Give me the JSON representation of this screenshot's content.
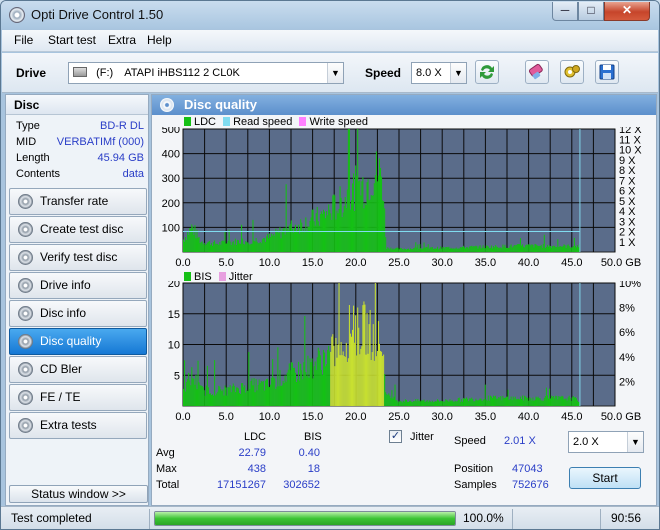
{
  "window": {
    "title": "Opti Drive Control 1.50",
    "controls": {
      "minimize": "─",
      "maximize": "□",
      "close": "✕"
    }
  },
  "menu": [
    "File",
    "Start test",
    "Extra",
    "Help"
  ],
  "toolbar": {
    "drive_label": "Drive",
    "drive_letter": "(F:)",
    "drive_value": "ATAPI  iHBS112   2 CL0K",
    "speed_label": "Speed",
    "speed_value": "8.0 X",
    "icons": [
      "refresh-icon",
      "eraser-icon",
      "settings-icon",
      "save-icon"
    ]
  },
  "sidebar": {
    "disc_header": "Disc",
    "info": [
      {
        "key": "Type",
        "value": "BD-R DL"
      },
      {
        "key": "MID",
        "value": "VERBATIMf (000)"
      },
      {
        "key": "Length",
        "value": "45.94 GB"
      },
      {
        "key": "Contents",
        "value": "data"
      }
    ],
    "nav": [
      "Transfer rate",
      "Create test disc",
      "Verify test disc",
      "Drive info",
      "Disc info",
      "Disc quality",
      "CD Bler",
      "FE / TE",
      "Extra tests"
    ],
    "active_nav": "Disc quality",
    "status_window": "Status window >>"
  },
  "panel": {
    "title": "Disc quality",
    "legend_top": [
      "LDC",
      "Read speed",
      "Write speed"
    ],
    "legend_bottom": [
      "BIS",
      "Jitter"
    ],
    "colors": {
      "ldc": "#15c015",
      "read": "#80dcf0",
      "write": "#ff80ff",
      "bis": "#15c015",
      "bis_peak": "#c8e030",
      "jitter": "#e8a0e0",
      "plot_bg": "#5a6c8a",
      "grid": "#0a0a0a"
    }
  },
  "stats": {
    "col_ldc": "LDC",
    "col_bis": "BIS",
    "rows": [
      {
        "label": "Avg",
        "ldc": "22.79",
        "bis": "0.40"
      },
      {
        "label": "Max",
        "ldc": "438",
        "bis": "18"
      },
      {
        "label": "Total",
        "ldc": "17151267",
        "bis": "302652"
      }
    ],
    "jitter_label": "Jitter",
    "jitter_checked": "✓",
    "speed_label": "Speed",
    "speed_value": "2.01 X",
    "speed_select": "2.0 X",
    "position_label": "Position",
    "position_value": "47043",
    "samples_label": "Samples",
    "samples_value": "752676",
    "start_label": "Start"
  },
  "statusbar": {
    "status": "Test completed",
    "progress_text": "100.0%",
    "progress": 1.0,
    "time": "90:56"
  },
  "chart_data": [
    {
      "type": "bar",
      "name": "ldc",
      "xlim": [
        0,
        50
      ],
      "ylim": [
        0,
        500
      ],
      "x_ticks": [
        "0.0",
        "5.0",
        "10.0",
        "15.0",
        "20.0",
        "25.0",
        "30.0",
        "35.0",
        "40.0",
        "45.0",
        "50.0 GB"
      ],
      "y_ticks_left": [
        "500",
        "400",
        "300",
        "200",
        "100"
      ],
      "y_ticks_right": [
        "12 X",
        "11 X",
        "10 X",
        "9 X",
        "8 X",
        "7 X",
        "6 X",
        "5 X",
        "4 X",
        "3 X",
        "2 X",
        "1 X"
      ],
      "data_end_gb": 45.94,
      "read_speed_x": 2.0,
      "ldc_envelope": [
        [
          0,
          60
        ],
        [
          1,
          120
        ],
        [
          2,
          50
        ],
        [
          4,
          40
        ],
        [
          6,
          50
        ],
        [
          8,
          55
        ],
        [
          10,
          70
        ],
        [
          12,
          110
        ],
        [
          14,
          140
        ],
        [
          16,
          170
        ],
        [
          18,
          230
        ],
        [
          19,
          270
        ],
        [
          20,
          310
        ],
        [
          21,
          320
        ],
        [
          22,
          380
        ],
        [
          23,
          370
        ],
        [
          23.5,
          20
        ],
        [
          25,
          15
        ],
        [
          30,
          20
        ],
        [
          35,
          25
        ],
        [
          40,
          30
        ],
        [
          45,
          28
        ],
        [
          45.94,
          30
        ]
      ]
    },
    {
      "type": "bar",
      "name": "bis",
      "xlim": [
        0,
        50
      ],
      "ylim": [
        0,
        20
      ],
      "x_ticks": [
        "0.0",
        "5.0",
        "10.0",
        "15.0",
        "20.0",
        "25.0",
        "30.0",
        "35.0",
        "40.0",
        "45.0",
        "50.0 GB"
      ],
      "y_ticks_left": [
        "20",
        "15",
        "10",
        "5"
      ],
      "y_ticks_right": [
        "10%",
        "8%",
        "6%",
        "4%",
        "2%"
      ],
      "data_end_gb": 45.94,
      "bis_envelope": [
        [
          0,
          3
        ],
        [
          1,
          6
        ],
        [
          2,
          3
        ],
        [
          5,
          3
        ],
        [
          8,
          4
        ],
        [
          10,
          4
        ],
        [
          12,
          6
        ],
        [
          14,
          7
        ],
        [
          16,
          9
        ],
        [
          18,
          11
        ],
        [
          19,
          13
        ],
        [
          19.7,
          18
        ],
        [
          20,
          14
        ],
        [
          21,
          15
        ],
        [
          22,
          13
        ],
        [
          23,
          12
        ],
        [
          23.5,
          2
        ],
        [
          25,
          1
        ],
        [
          30,
          1
        ],
        [
          35,
          1.5
        ],
        [
          40,
          1.5
        ],
        [
          45,
          1.5
        ],
        [
          45.94,
          1
        ]
      ]
    }
  ]
}
